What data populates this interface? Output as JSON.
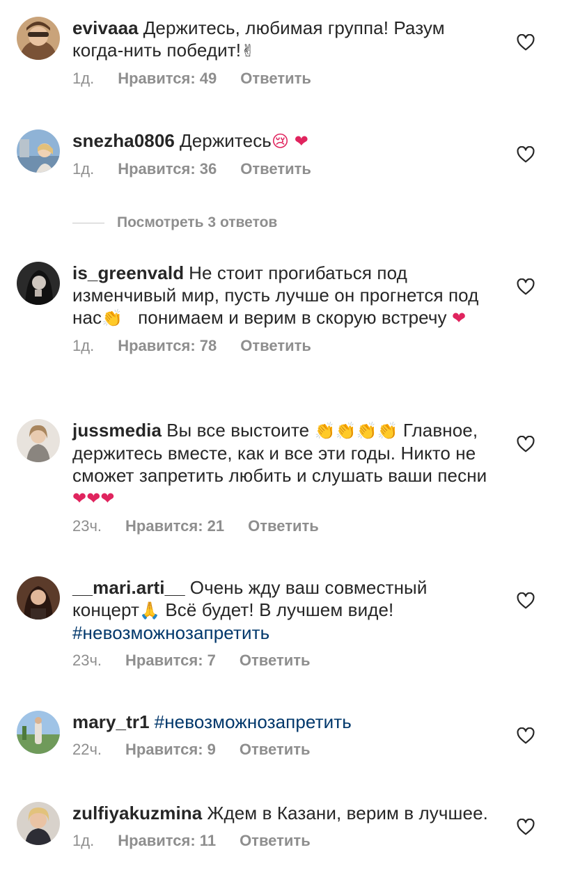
{
  "comments": [
    {
      "username": "evivaaa",
      "text": "Держитесь, любимая группа! Разум когда-нить победит!",
      "emoji_after": "✌",
      "time": "1д.",
      "likes": "Нравится: 49",
      "reply": "Ответить"
    },
    {
      "username": "snezha0806",
      "text": "Держитесь",
      "emoji_after": "😢 ❤",
      "time": "1д.",
      "likes": "Нравится: 36",
      "reply": "Ответить"
    },
    {
      "username": "is_greenvald",
      "text": "Не стоит прогибаться под изменчивый мир, пусть лучше он прогнется под нас",
      "emoji_mid": "👏",
      "text2": "понимаем и верим в скорую встречу",
      "emoji_after": "❤",
      "time": "1д.",
      "likes": "Нравится: 78",
      "reply": "Ответить"
    },
    {
      "username": "jussmedia",
      "text": "Вы все выстоите",
      "emoji_mid": "👏👏👏👏",
      "text2": "Главное, держитесь вместе, как и все эти годы. Никто не сможет запретить любить и слушать ваши песни",
      "emoji_after": "❤❤❤",
      "time": "23ч.",
      "likes": "Нравится: 21",
      "reply": "Ответить"
    },
    {
      "username": "__mari.arti__",
      "text": "Очень жду ваш совместный концерт",
      "emoji_mid": "🙏",
      "text2": "Всё будет! В лучшем виде!",
      "hashtag": "#невозможнозапретить",
      "time": "23ч.",
      "likes": "Нравится: 7",
      "reply": "Ответить"
    },
    {
      "username": "mary_tr1",
      "hashtag": "#невозможнозапретить",
      "time": "22ч.",
      "likes": "Нравится: 9",
      "reply": "Ответить"
    },
    {
      "username": "zulfiyakuzmina",
      "text": "Ждем в Казани, верим в лучшее.",
      "time": "1д.",
      "likes": "Нравится: 11",
      "reply": "Ответить"
    }
  ],
  "view_replies": "Посмотреть 3 ответов",
  "icons": {
    "like": "heart-outline-icon"
  },
  "colors": {
    "meta": "#8e8e8e",
    "hashtag": "#00376b",
    "heart": "#e0245e"
  }
}
